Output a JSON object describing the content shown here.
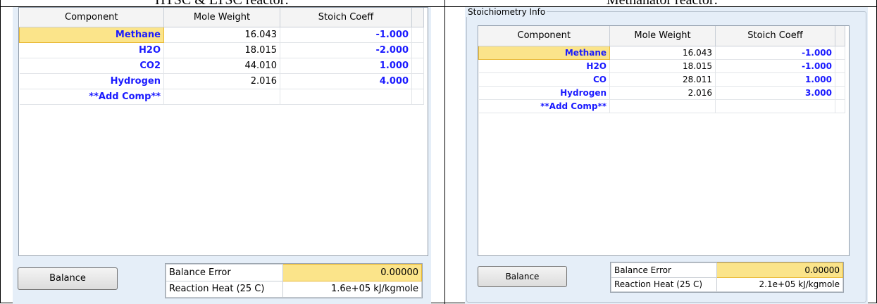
{
  "captions": {
    "left": "HTSC & LTSC reactor:",
    "right": "Methanator reactor:"
  },
  "left_panel": {
    "columns": [
      "Component",
      "Mole Weight",
      "Stoich Coeff"
    ],
    "rows": [
      {
        "component": "Methane",
        "mole_weight": "16.043",
        "stoich": "-1.000"
      },
      {
        "component": "H2O",
        "mole_weight": "18.015",
        "stoich": "-2.000"
      },
      {
        "component": "CO2",
        "mole_weight": "44.010",
        "stoich": "1.000"
      },
      {
        "component": "Hydrogen",
        "mole_weight": "2.016",
        "stoich": "4.000"
      },
      {
        "component": "**Add Comp**",
        "mole_weight": "",
        "stoich": ""
      }
    ],
    "balance_button": "Balance",
    "balance_error_label": "Balance Error",
    "balance_error_value": "0.00000",
    "reaction_heat_label": "Reaction Heat (25 C)",
    "reaction_heat_value": "1.6e+05 kJ/kgmole"
  },
  "right_panel": {
    "group_title": "Stoichiometry Info",
    "columns": [
      "Component",
      "Mole Weight",
      "Stoich Coeff"
    ],
    "rows": [
      {
        "component": "Methane",
        "mole_weight": "16.043",
        "stoich": "-1.000"
      },
      {
        "component": "H2O",
        "mole_weight": "18.015",
        "stoich": "-1.000"
      },
      {
        "component": "CO",
        "mole_weight": "28.011",
        "stoich": "1.000"
      },
      {
        "component": "Hydrogen",
        "mole_weight": "2.016",
        "stoich": "3.000"
      },
      {
        "component": "**Add Comp**",
        "mole_weight": "",
        "stoich": ""
      }
    ],
    "balance_button": "Balance",
    "balance_error_label": "Balance Error",
    "balance_error_value": "0.00000",
    "reaction_heat_label": "Reaction Heat (25 C)",
    "reaction_heat_value": "2.1e+05 kJ/kgmole"
  },
  "colors": {
    "panel_bg": "#e5eef8",
    "component_text": "#1a1aff",
    "selected_cell": "#fbe48a"
  }
}
